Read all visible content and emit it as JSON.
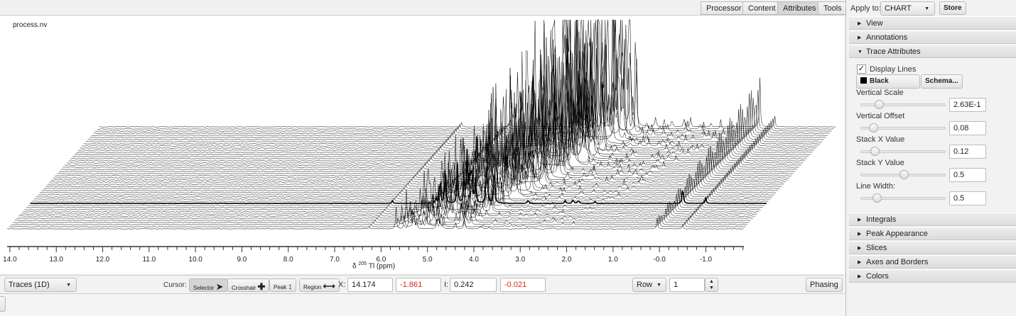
{
  "tabs": [
    "Processor",
    "Content",
    "Attributes",
    "Tools"
  ],
  "selected_tab": "Attributes",
  "chart": {
    "file_label": "process.nv"
  },
  "chart_data": {
    "type": "line",
    "subtype": "stacked-1d-traces",
    "xlabel_prefix": "δ",
    "xlabel_isotope_mass": "205",
    "xlabel_suffix": "Tl (ppm)",
    "xlim": [
      14.06,
      -1.82
    ],
    "x_reversed": true,
    "xticks": [
      "14.0",
      "13.0",
      "12.0",
      "11.0",
      "10.0",
      "9.0",
      "8.0",
      "7.0",
      "6.0",
      "5.0",
      "4.0",
      "3.0",
      "2.0",
      "1.0",
      "-0.0",
      "-1.0"
    ],
    "xtick_values": [
      14,
      13,
      12,
      11,
      10,
      9,
      8,
      7,
      6,
      5,
      4,
      3,
      2,
      1,
      0,
      -1
    ],
    "trace_count": 49,
    "highlighted_trace": 12,
    "line_color": "#000000",
    "peak_groups": [
      {
        "ppm_start": 6.25,
        "ppm_end": 6.25,
        "rel_height_start": 0.01,
        "rel_height_end": 0.02
      },
      {
        "ppm_start": 5.35,
        "ppm_end": 5.2,
        "rel_height_start": 0.02,
        "rel_height_end": 0.04
      },
      {
        "ppm_start": 5.0,
        "ppm_end": 3.1,
        "rel_height_start": 0.05,
        "rel_height_end": 0.55
      },
      {
        "ppm_start": 3.0,
        "ppm_end": 1.3,
        "rel_height_start": 0.01,
        "rel_height_end": 0.03
      },
      {
        "ppm_start": 0.05,
        "ppm_end": -0.18,
        "rel_height_start": 0.05,
        "rel_height_end": 0.22
      },
      {
        "ppm_start": -0.5,
        "ppm_end": -0.5,
        "rel_height_start": 0.02,
        "rel_height_end": 0.05
      }
    ]
  },
  "panel": {
    "apply_to_label": "Apply to:",
    "apply_to_value": "CHART",
    "store_label": "Store",
    "sections_top": [
      {
        "label": "View",
        "expanded": false
      },
      {
        "label": "Annotations",
        "expanded": false
      },
      {
        "label": "Trace Attributes",
        "expanded": true
      }
    ],
    "display_lines_label": "Display Lines",
    "display_lines_checked": true,
    "color_label": "Black",
    "schema_label": "Schema...",
    "sliders": [
      {
        "label": "Vertical Scale",
        "value": "2.63E-1",
        "position": 0.18
      },
      {
        "label": "Vertical Offset",
        "value": "0.08",
        "position": 0.1
      },
      {
        "label": "Stack X Value",
        "value": "0.12",
        "position": 0.12
      },
      {
        "label": "Stack Y Value",
        "value": "0.5",
        "position": 0.5
      },
      {
        "label": "Line Width:",
        "value": "0.5",
        "position": 0.15
      }
    ],
    "sections_bottom": [
      {
        "label": "Integrals"
      },
      {
        "label": "Peak Appearance"
      },
      {
        "label": "Slices"
      },
      {
        "label": "Axes and Borders"
      },
      {
        "label": "Colors"
      }
    ]
  },
  "bottom": {
    "display_mode": "Traces (1D)",
    "cursor_label": "Cursor:",
    "cursor_modes": [
      "Selector",
      "Crosshair",
      "Peak",
      "Region"
    ],
    "selected_cursor": "Selector",
    "x_label": "X:",
    "x_value": "14.174",
    "x_delta": "-1.861",
    "i_label": "I:",
    "i_value": "0.242",
    "i_delta": "-0.021",
    "row_select": "Row",
    "row_value": "1",
    "phasing_label": "Phasing",
    "accent_red": "#e02020"
  }
}
